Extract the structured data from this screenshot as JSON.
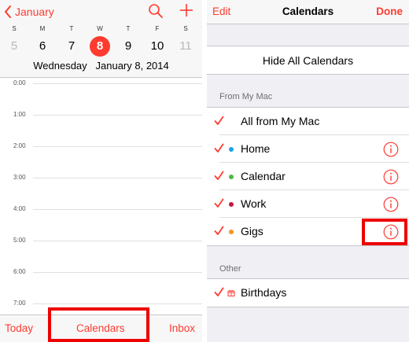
{
  "day_view": {
    "back_label": "January",
    "weekdays": [
      "S",
      "M",
      "T",
      "W",
      "T",
      "F",
      "S"
    ],
    "dates": [
      "5",
      "6",
      "7",
      "8",
      "9",
      "10",
      "11"
    ],
    "selected_index": 3,
    "date_line": "Wednesday   January 8, 2014",
    "hours": [
      "0:00",
      "1:00",
      "2:00",
      "3:00",
      "4:00",
      "5:00",
      "6:00",
      "7:00"
    ],
    "toolbar": {
      "today_label": "Today",
      "calendars_label": "Calendars",
      "inbox_label": "Inbox"
    }
  },
  "calendars_panel": {
    "edit_label": "Edit",
    "title": "Calendars",
    "done_label": "Done",
    "hide_all_label": "Hide All Calendars",
    "sections": [
      {
        "header": "From My Mac",
        "rows": [
          {
            "label": "All from My Mac",
            "checked": true,
            "color": null,
            "info": false
          },
          {
            "label": "Home",
            "checked": true,
            "color": "#1aa1e8",
            "info": true
          },
          {
            "label": "Calendar",
            "checked": true,
            "color": "#4cb848",
            "info": true
          },
          {
            "label": "Work",
            "checked": true,
            "color": "#c4183c",
            "info": true
          },
          {
            "label": "Gigs",
            "checked": true,
            "color": "#f89322",
            "info": true
          }
        ]
      },
      {
        "header": "Other",
        "rows": [
          {
            "label": "Birthdays",
            "checked": true,
            "icon": "gift-icon",
            "info": false
          }
        ]
      }
    ]
  },
  "colors": {
    "accent": "#ff3b30",
    "highlight": "#ee0000"
  }
}
